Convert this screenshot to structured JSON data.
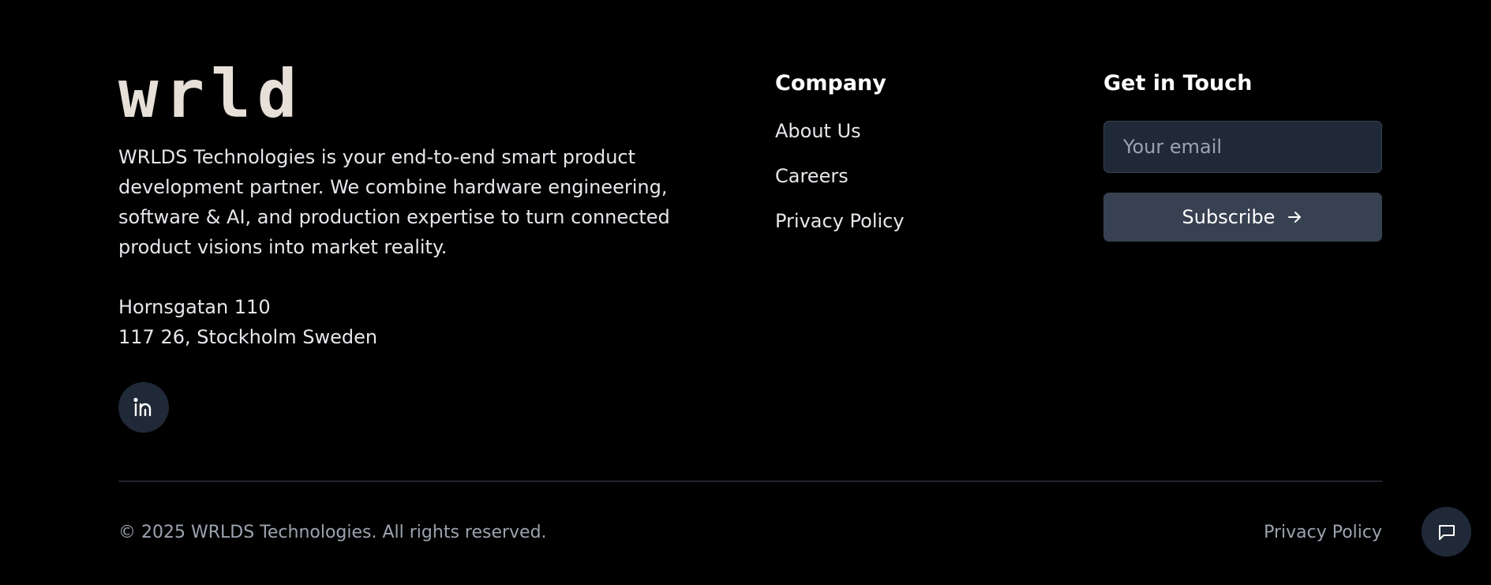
{
  "brand": {
    "logo_text": "wrlds",
    "logo_color": "#e7e0d8",
    "description": "WRLDS Technologies is your end-to-end smart product development partner. We combine hardware engineering, software & AI, and production expertise to turn connected product visions into market reality.",
    "address_line1": "Hornsgatan 110",
    "address_line2": "117 26, Stockholm Sweden"
  },
  "social": {
    "linkedin_icon": "linkedin-icon"
  },
  "company": {
    "title": "Company",
    "links": [
      {
        "label": "About Us"
      },
      {
        "label": "Careers"
      },
      {
        "label": "Privacy Policy"
      }
    ]
  },
  "contact": {
    "title": "Get in Touch",
    "email_placeholder": "Your email",
    "email_value": "",
    "subscribe_label": "Subscribe",
    "subscribe_icon": "arrow-right-icon"
  },
  "bottom": {
    "copyright": "© 2025 WRLDS Technologies. All rights reserved.",
    "privacy_link": "Privacy Policy"
  },
  "chat": {
    "icon": "chat-icon"
  },
  "colors": {
    "background": "#000000",
    "text": "#e5e7eb",
    "muted": "#9ca3af",
    "surface": "#1f2937",
    "button": "#374151"
  }
}
